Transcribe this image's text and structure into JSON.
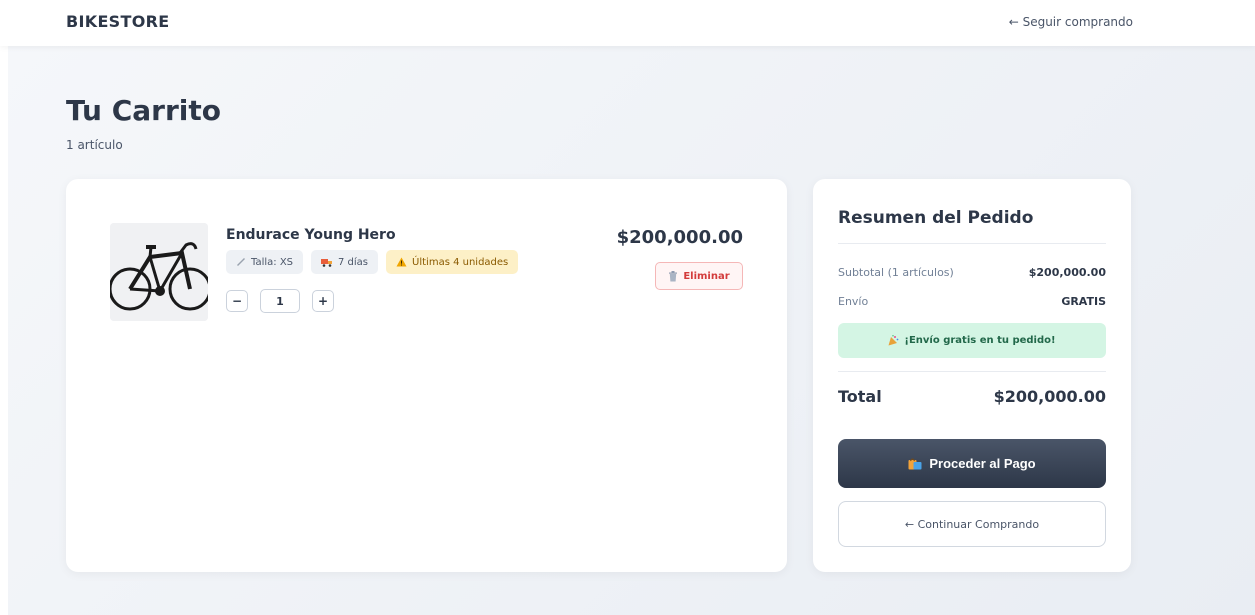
{
  "header": {
    "brand": "BIKESTORE",
    "back_link": "← Seguir comprando"
  },
  "page": {
    "title": "Tu Carrito",
    "item_count": "1 artículo"
  },
  "cart": {
    "items": [
      {
        "name": "Endurace Young Hero",
        "size_tag": "Talla: XS",
        "delivery_tag": "7 días",
        "stock_tag": "Últimas 4 unidades",
        "quantity": "1",
        "price": "$200,000.00",
        "remove_label": "Eliminar"
      }
    ]
  },
  "summary": {
    "title": "Resumen del Pedido",
    "subtotal_label": "Subtotal (1 artículos)",
    "subtotal_value": "$200,000.00",
    "shipping_label": "Envío",
    "shipping_value": "GRATIS",
    "free_shipping_banner": "¡Envío gratis en tu pedido!",
    "total_label": "Total",
    "total_value": "$200,000.00",
    "pay_button": "Proceder al Pago",
    "continue_button": "← Continuar Comprando"
  },
  "icons": {
    "size": "ruler-icon",
    "delivery": "truck-icon",
    "stock": "warning-icon",
    "remove": "trash-icon",
    "banner": "party-icon",
    "pay": "shopping-bags-icon"
  },
  "colors": {
    "primary": "#2d3748",
    "danger": "#d33c3c",
    "success_bg": "#d4f5e4",
    "warning_bg": "#fdf0c7"
  }
}
